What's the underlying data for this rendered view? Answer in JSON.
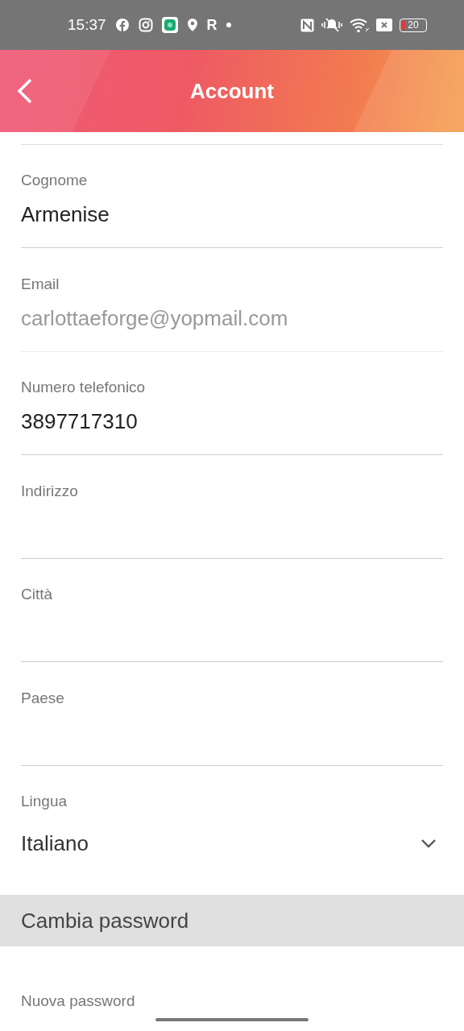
{
  "status_bar": {
    "time": "15:37",
    "app_letter": "R",
    "battery": "20"
  },
  "header": {
    "title": "Account"
  },
  "fields": [
    {
      "kind": "text",
      "label": "Cognome",
      "value": "Armenise",
      "disabled": false
    },
    {
      "kind": "text",
      "label": "Email",
      "value": "carlottaeforge@yopmail.com",
      "disabled": true
    },
    {
      "kind": "text",
      "label": "Numero telefonico",
      "value": "3897717310",
      "disabled": false
    },
    {
      "kind": "text",
      "label": "Indirizzo",
      "disabled": false
    },
    {
      "kind": "text",
      "label": "Città",
      "disabled": false
    },
    {
      "kind": "text",
      "label": "Paese",
      "disabled": false
    },
    {
      "kind": "select",
      "label": "Lingua",
      "value": "Italiano",
      "disabled": false
    }
  ],
  "section": {
    "title": "Cambia password"
  },
  "password_fields": [
    {
      "label": "Nuova password"
    }
  ]
}
